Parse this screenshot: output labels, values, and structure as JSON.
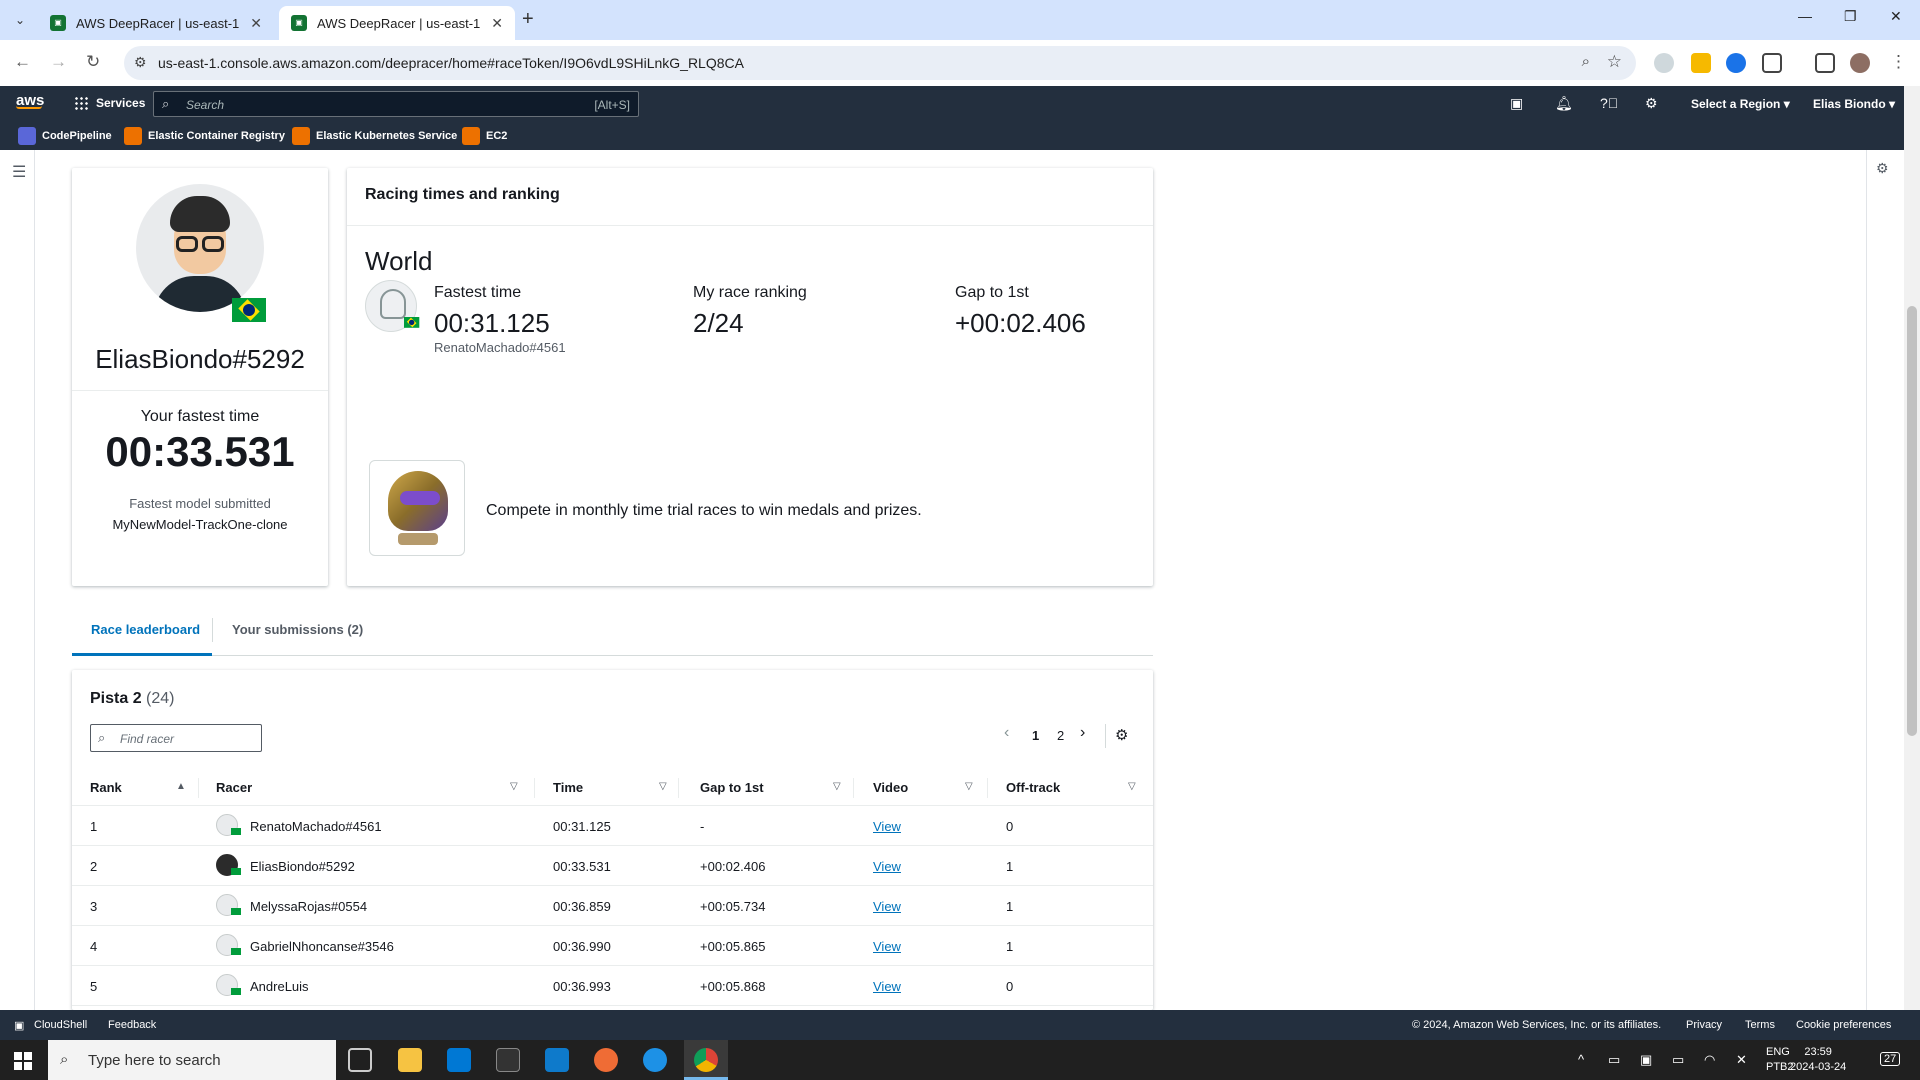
{
  "browser": {
    "tabs": [
      {
        "label": "AWS DeepRacer | us-east-1"
      },
      {
        "label": "AWS DeepRacer | us-east-1"
      }
    ],
    "url": "us-east-1.console.aws.amazon.com/deepracer/home#raceToken/I9O6vdL9SHiLnkG_RLQ8CA"
  },
  "aws_header": {
    "logo": "aws",
    "services_label": "Services",
    "search_placeholder": "Search",
    "search_shortcut": "[Alt+S]",
    "region_label": "Select a Region",
    "user_label": "Elias Biondo"
  },
  "favorites": [
    {
      "label": "CodePipeline",
      "color": "#5a67d8"
    },
    {
      "label": "Elastic Container Registry",
      "color": "#ed7100"
    },
    {
      "label": "Elastic Kubernetes Service",
      "color": "#ed7100"
    },
    {
      "label": "EC2",
      "color": "#ed7100"
    }
  ],
  "profile": {
    "username": "EliasBiondo#5292",
    "fastest_label": "Your fastest time",
    "fastest_time": "00:33.531",
    "model_label": "Fastest model submitted",
    "model_name": "MyNewModel-TrackOne-clone"
  },
  "racing": {
    "title": "Racing times and ranking",
    "scope": "World",
    "fastest_label": "Fastest time",
    "fastest_value": "00:31.125",
    "fastest_holder": "RenatoMachado#4561",
    "ranking_label": "My race ranking",
    "ranking_value": "2/24",
    "gap_label": "Gap to 1st",
    "gap_value": "+00:02.406",
    "promo_text": "Compete in monthly time trial races to win medals and prizes."
  },
  "tabs": [
    {
      "label": "Race leaderboard",
      "active": true
    },
    {
      "label": "Your submissions (2)",
      "active": false
    }
  ],
  "leaderboard": {
    "track_name": "Pista 2",
    "count": "(24)",
    "find_placeholder": "Find racer",
    "pages": [
      "1",
      "2"
    ],
    "current_page": "1",
    "columns": [
      "Rank",
      "Racer",
      "Time",
      "Gap to 1st",
      "Video",
      "Off-track"
    ],
    "rows": [
      {
        "rank": "1",
        "racer": "RenatoMachado#4561",
        "time": "00:31.125",
        "gap": "-",
        "video": "View",
        "offtrack": "0"
      },
      {
        "rank": "2",
        "racer": "EliasBiondo#5292",
        "time": "00:33.531",
        "gap": "+00:02.406",
        "video": "View",
        "offtrack": "1"
      },
      {
        "rank": "3",
        "racer": "MelyssaRojas#0554",
        "time": "00:36.859",
        "gap": "+00:05.734",
        "video": "View",
        "offtrack": "1"
      },
      {
        "rank": "4",
        "racer": "GabrielNhoncanse#3546",
        "time": "00:36.990",
        "gap": "+00:05.865",
        "video": "View",
        "offtrack": "1"
      },
      {
        "rank": "5",
        "racer": "AndreLuis",
        "time": "00:36.993",
        "gap": "+00:05.868",
        "video": "View",
        "offtrack": "0"
      }
    ]
  },
  "footer": {
    "cloudshell": "CloudShell",
    "feedback": "Feedback",
    "copyright": "© 2024, Amazon Web Services, Inc. or its affiliates.",
    "privacy": "Privacy",
    "terms": "Terms",
    "cookies": "Cookie preferences"
  },
  "taskbar": {
    "search_placeholder": "Type here to search",
    "lang_line1": "ENG",
    "lang_line2": "PTB2",
    "time": "23:59",
    "date": "2024-03-24",
    "notifications": "27"
  },
  "colors": {
    "aws_dark": "#232f3e",
    "link_blue": "#0073bb",
    "aws_orange": "#ff9900"
  }
}
